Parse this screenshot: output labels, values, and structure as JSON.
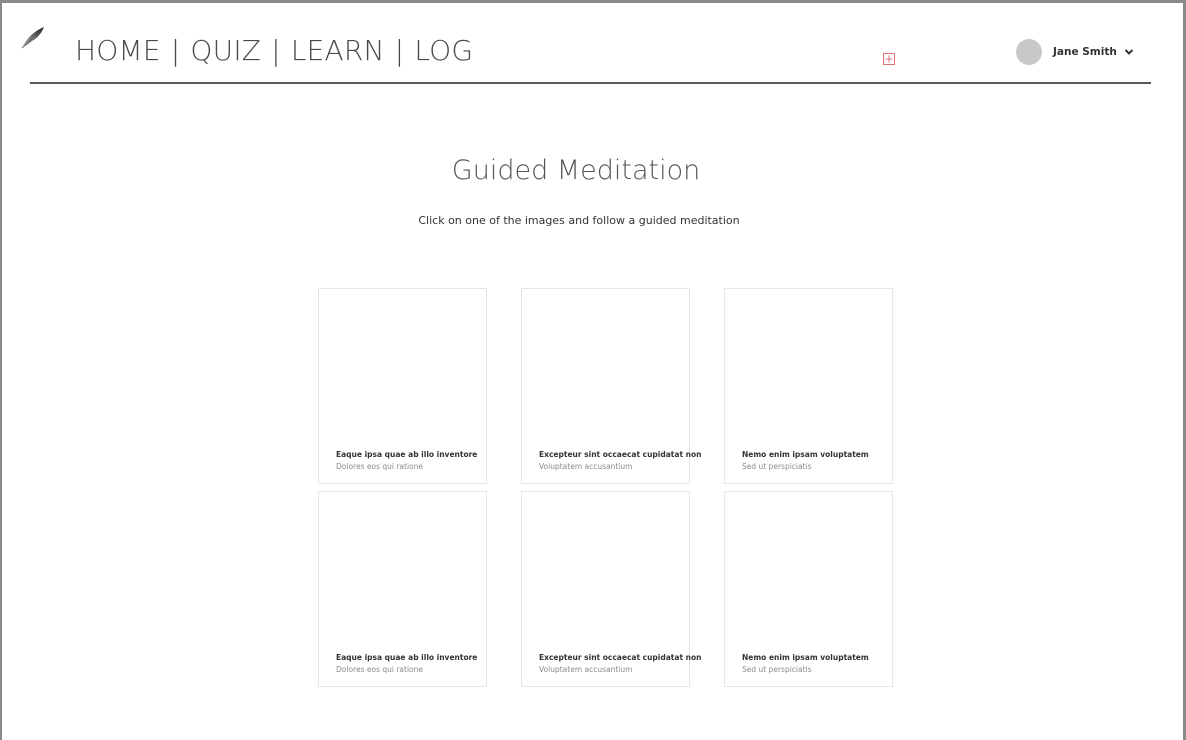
{
  "header": {
    "logo_icon": "feather-icon",
    "nav": [
      {
        "label": "HOME"
      },
      {
        "label": "QUIZ"
      },
      {
        "label": "LEARN"
      },
      {
        "label": "LOG"
      }
    ],
    "separator": "|",
    "add_icon": "add-box-icon",
    "add_icon_color": "#e57373",
    "user": {
      "name": "Jane Smith",
      "chevron_icon": "chevron-down-icon"
    }
  },
  "main": {
    "title": "Guided Meditation",
    "subtitle": "Click on one of the images and follow a guided meditation",
    "cards": [
      {
        "title": "Eaque ipsa quae ab illo inventore",
        "subtitle": "Dolores eos qui ratione"
      },
      {
        "title": "Excepteur sint occaecat cupidatat non",
        "subtitle": "Voluptatem accusantium"
      },
      {
        "title": "Nemo enim ipsam voluptatem",
        "subtitle": "Sed ut perspiciatis"
      },
      {
        "title": "Eaque ipsa quae ab illo inventore",
        "subtitle": "Dolores eos qui ratione"
      },
      {
        "title": "Excepteur sint occaecat cupidatat non",
        "subtitle": "Voluptatem accusantium"
      },
      {
        "title": "Nemo enim ipsam voluptatem",
        "subtitle": "Sed ut perspiciatis"
      }
    ]
  }
}
